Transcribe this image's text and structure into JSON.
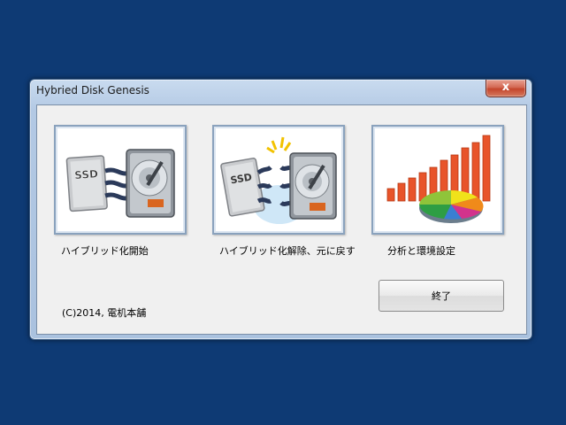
{
  "window": {
    "title": "Hybried Disk Genesis",
    "close_label": "x"
  },
  "tiles": [
    {
      "caption": "ハイブリッド化開始",
      "badge": "SSD",
      "icon": "ssd-to-hdd-connect-icon"
    },
    {
      "caption": "ハイブリッド化解除、元に戻す",
      "badge": "SSD",
      "icon": "ssd-hdd-disconnect-icon"
    },
    {
      "caption": "分析と環境設定",
      "icon": "bar-pie-chart-icon"
    }
  ],
  "copyright": "(C)2014, 電机本舗",
  "exit_button": "終了",
  "colors": {
    "desktop": "#0e3a74",
    "accent_orange": "#e8542a"
  }
}
